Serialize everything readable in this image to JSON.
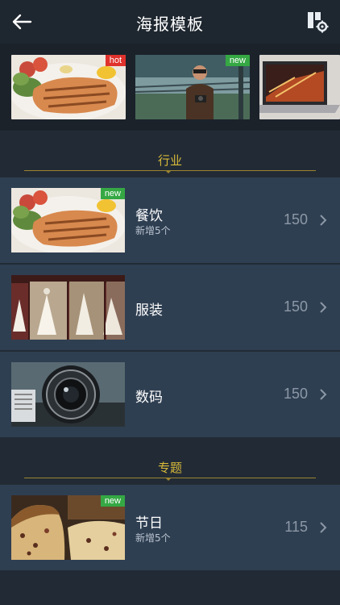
{
  "header": {
    "title": "海报模板",
    "back_icon": "arrow-left-icon",
    "settings_icon": "layout-settings-icon"
  },
  "banner": {
    "items": [
      {
        "badge": "hot",
        "image": "grilled-salmon"
      },
      {
        "badge": "new",
        "image": "man-with-camera"
      },
      {
        "badge": "",
        "image": "laptop-screen"
      }
    ]
  },
  "sections": [
    {
      "title": "行业",
      "rows": [
        {
          "name": "餐饮",
          "sub": "新增5个",
          "count": "150",
          "badge": "new",
          "image": "grilled-salmon"
        },
        {
          "name": "服装",
          "sub": "",
          "count": "150",
          "badge": "",
          "image": "dress-shop"
        },
        {
          "name": "数码",
          "sub": "",
          "count": "150",
          "badge": "",
          "image": "camera-lens"
        }
      ]
    },
    {
      "title": "专题",
      "rows": [
        {
          "name": "节日",
          "sub": "新增5个",
          "count": "115",
          "badge": "new",
          "image": "festive-bread"
        }
      ]
    }
  ],
  "colors": {
    "accent": "#d8b93a",
    "row_bg": "#2f3f52",
    "page_bg": "#222b35",
    "hot": "#e0322c",
    "new": "#35a844"
  }
}
